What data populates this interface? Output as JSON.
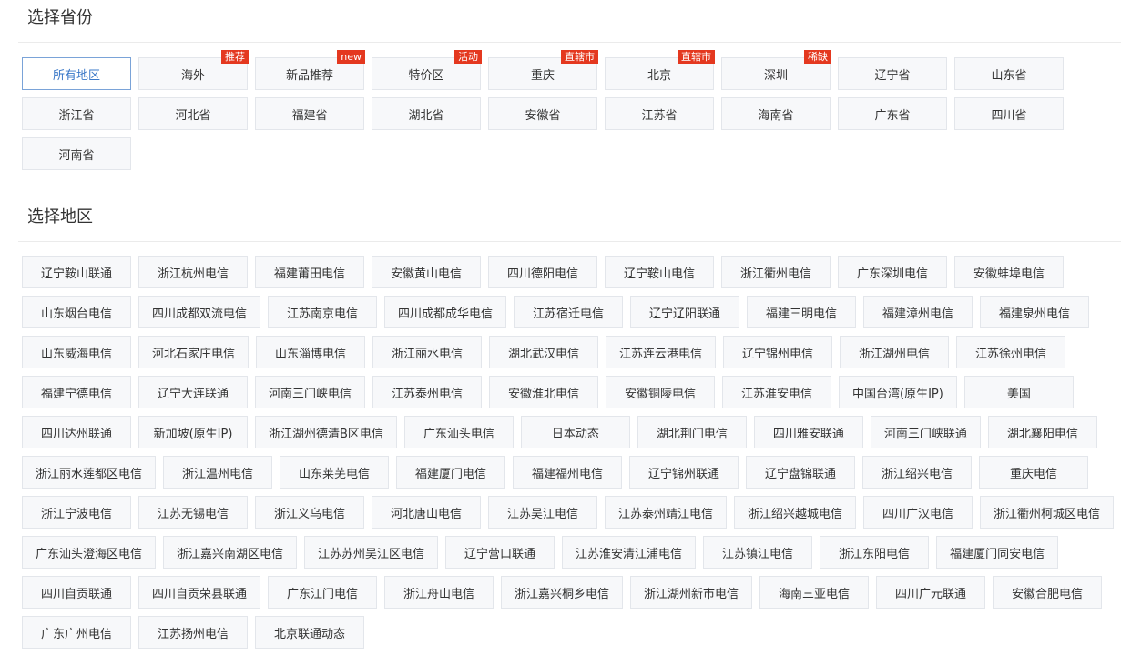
{
  "province_section": {
    "title": "选择省份",
    "items": [
      {
        "label": "所有地区",
        "badge": "",
        "active": true
      },
      {
        "label": "海外",
        "badge": "推荐"
      },
      {
        "label": "新品推荐",
        "badge": "new"
      },
      {
        "label": "特价区",
        "badge": "活动"
      },
      {
        "label": "重庆",
        "badge": "直辖市"
      },
      {
        "label": "北京",
        "badge": "直辖市"
      },
      {
        "label": "深圳",
        "badge": "稀缺"
      },
      {
        "label": "辽宁省",
        "badge": ""
      },
      {
        "label": "山东省",
        "badge": ""
      },
      {
        "label": "浙江省",
        "badge": ""
      },
      {
        "label": "河北省",
        "badge": ""
      },
      {
        "label": "福建省",
        "badge": ""
      },
      {
        "label": "湖北省",
        "badge": ""
      },
      {
        "label": "安徽省",
        "badge": ""
      },
      {
        "label": "江苏省",
        "badge": ""
      },
      {
        "label": "海南省",
        "badge": ""
      },
      {
        "label": "广东省",
        "badge": ""
      },
      {
        "label": "四川省",
        "badge": ""
      },
      {
        "label": "河南省",
        "badge": ""
      }
    ]
  },
  "region_section": {
    "title": "选择地区",
    "items": [
      "辽宁鞍山联通",
      "浙江杭州电信",
      "福建莆田电信",
      "安徽黄山电信",
      "四川德阳电信",
      "辽宁鞍山电信",
      "浙江衢州电信",
      "广东深圳电信",
      "安徽蚌埠电信",
      "山东烟台电信",
      "四川成都双流电信",
      "江苏南京电信",
      "四川成都成华电信",
      "江苏宿迁电信",
      "辽宁辽阳联通",
      "福建三明电信",
      "福建漳州电信",
      "福建泉州电信",
      "山东威海电信",
      "河北石家庄电信",
      "山东淄博电信",
      "浙江丽水电信",
      "湖北武汉电信",
      "江苏连云港电信",
      "辽宁锦州电信",
      "浙江湖州电信",
      "江苏徐州电信",
      "福建宁德电信",
      "辽宁大连联通",
      "河南三门峡电信",
      "江苏泰州电信",
      "安徽淮北电信",
      "安徽铜陵电信",
      "江苏淮安电信",
      "中国台湾(原生IP)",
      "美国",
      "四川达州联通",
      "新加坡(原生IP)",
      "浙江湖州德清B区电信",
      "广东汕头电信",
      "日本动态",
      "湖北荆门电信",
      "四川雅安联通",
      "河南三门峡联通",
      "湖北襄阳电信",
      "浙江丽水莲都区电信",
      "浙江温州电信",
      "山东莱芜电信",
      "福建厦门电信",
      "福建福州电信",
      "辽宁锦州联通",
      "辽宁盘锦联通",
      "浙江绍兴电信",
      "重庆电信",
      "浙江宁波电信",
      "江苏无锡电信",
      "浙江义乌电信",
      "河北唐山电信",
      "江苏吴江电信",
      "江苏泰州靖江电信",
      "浙江绍兴越城电信",
      "四川广汉电信",
      "浙江衢州柯城区电信",
      "广东汕头澄海区电信",
      "浙江嘉兴南湖区电信",
      "江苏苏州吴江区电信",
      "辽宁营口联通",
      "江苏淮安清江浦电信",
      "江苏镇江电信",
      "浙江东阳电信",
      "福建厦门同安电信",
      "四川自贡联通",
      "四川自贡荣县联通",
      "广东江门电信",
      "浙江舟山电信",
      "浙江嘉兴桐乡电信",
      "浙江湖州新市电信",
      "海南三亚电信",
      "四川广元联通",
      "安徽合肥电信",
      "广东广州电信",
      "江苏扬州电信",
      "北京联通动态"
    ]
  },
  "colors": {
    "badge": "#e4381f",
    "active_border": "#7aa3d8",
    "active_text": "#3a78c8"
  }
}
